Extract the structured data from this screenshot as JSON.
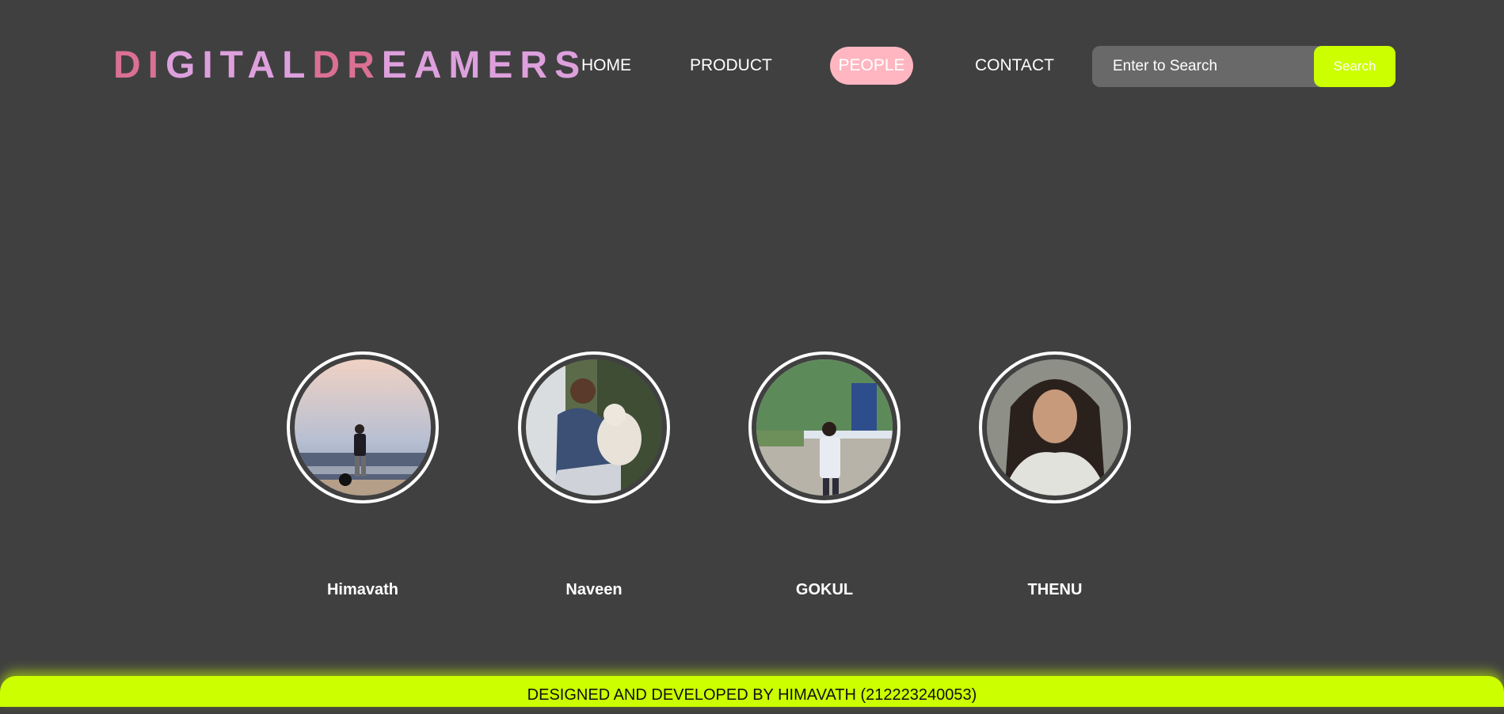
{
  "logo": {
    "part1": "DI",
    "part2": "GITAL",
    "part3": "DR",
    "part4": "EAMERS"
  },
  "nav": {
    "home": "HOME",
    "product": "PRODUCT",
    "people": "PEOPLE",
    "contact": "CONTACT",
    "active": "PEOPLE"
  },
  "search": {
    "placeholder": "Enter to Search",
    "button_label": "Search"
  },
  "people": [
    {
      "name": "Himavath"
    },
    {
      "name": "Naveen"
    },
    {
      "name": "GOKUL"
    },
    {
      "name": "THENU"
    }
  ],
  "footer": {
    "text": "DESIGNED AND DEVELOPED BY HIMAVATH (212223240053)"
  },
  "colors": {
    "background": "#404040",
    "accent": "#ccff00",
    "active_nav": "#ffb6c1",
    "logo_pink": "#db7093",
    "logo_plum": "#dda0dd"
  }
}
